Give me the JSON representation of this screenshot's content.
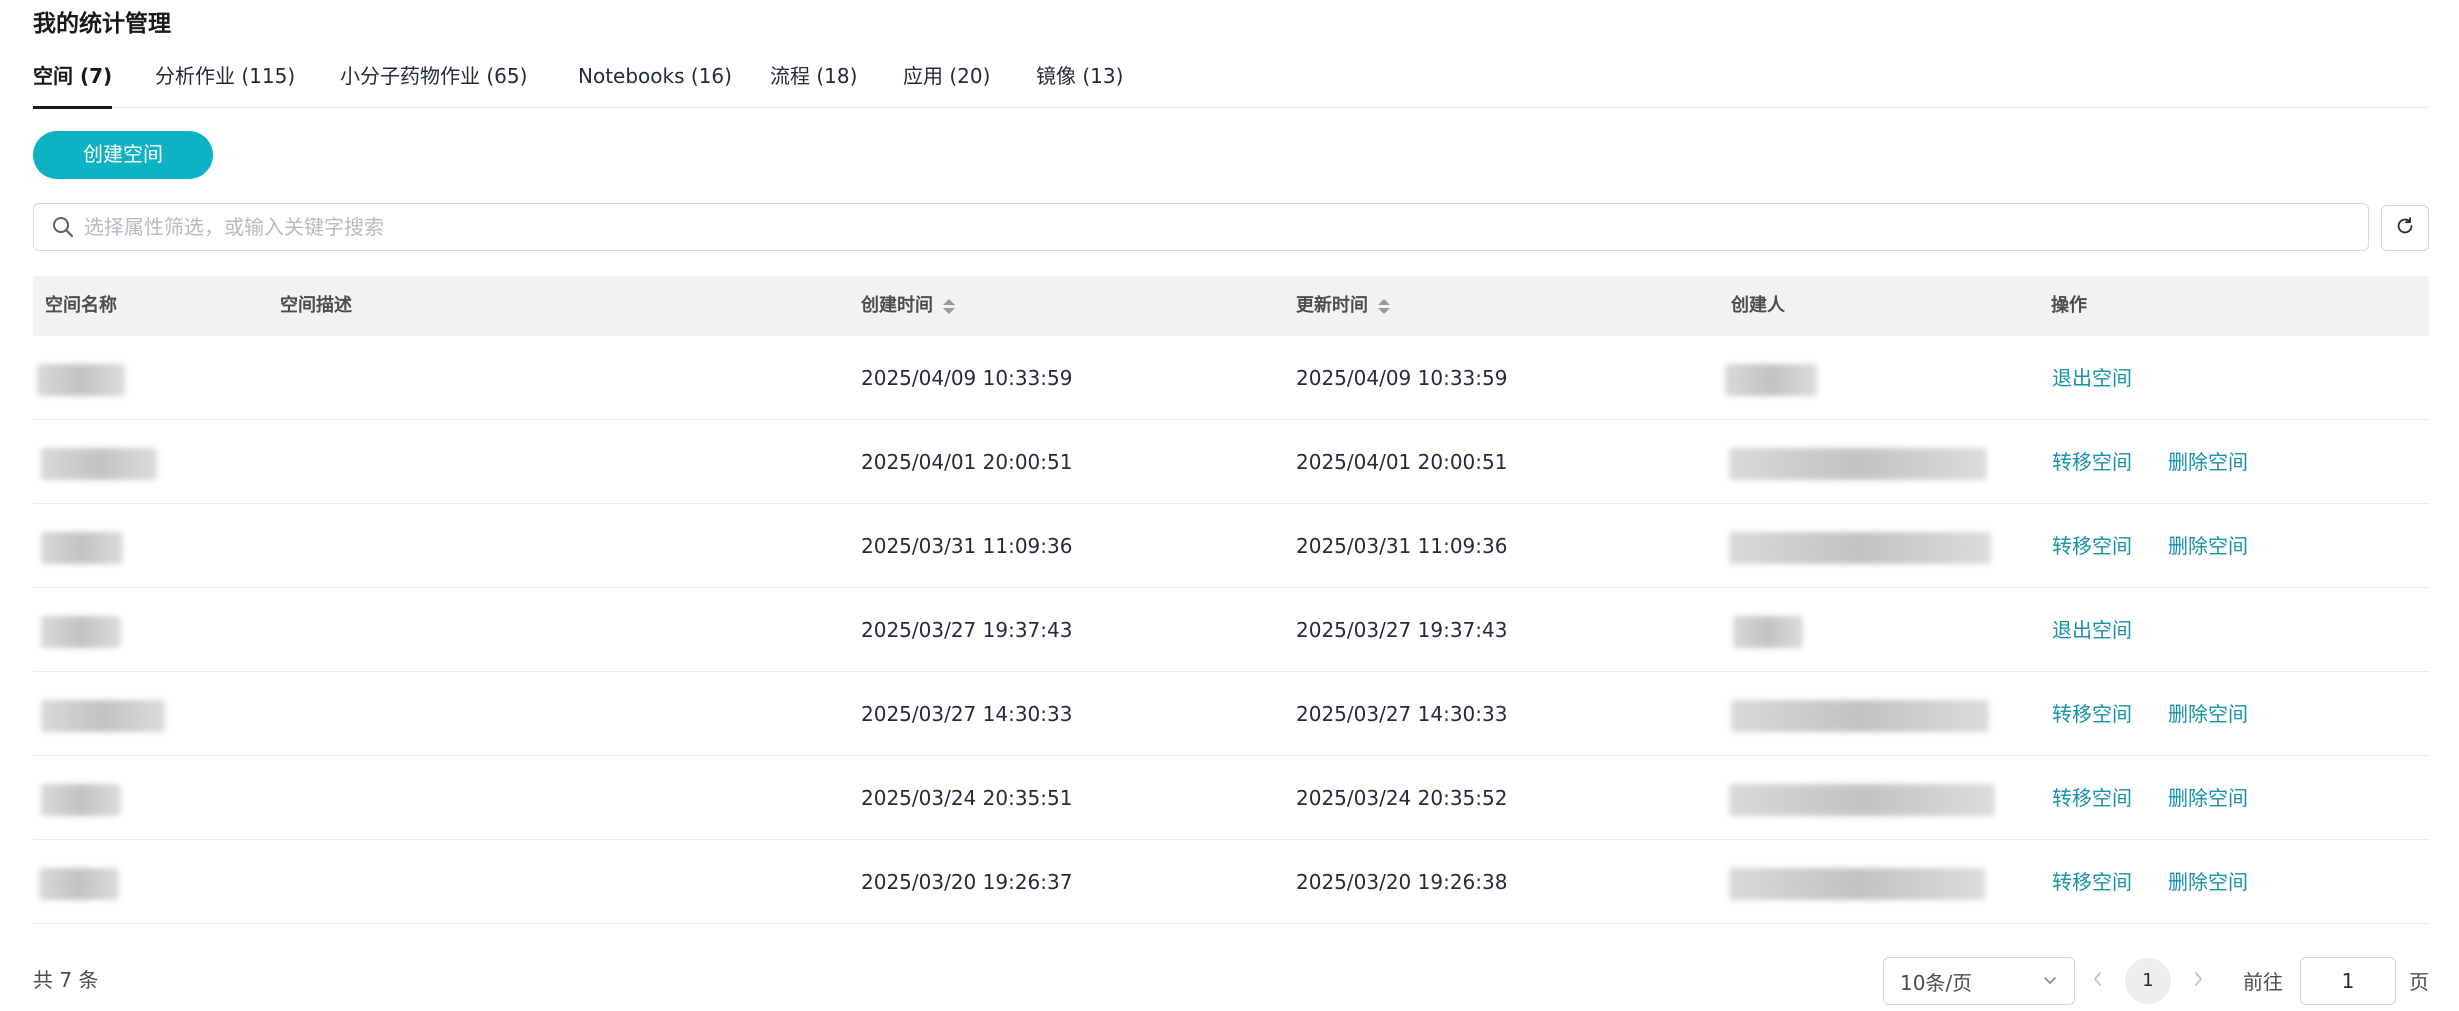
{
  "page": {
    "title": "我的统计管理"
  },
  "tabs": [
    {
      "label": "空间 (7)",
      "active": true
    },
    {
      "label": "分析作业 (115)"
    },
    {
      "label": "小分子药物作业 (65)"
    },
    {
      "label": "Notebooks (16)"
    },
    {
      "label": "流程 (18)"
    },
    {
      "label": "应用 (20)"
    },
    {
      "label": "镜像 (13)"
    }
  ],
  "toolbar": {
    "create_label": "创建空间"
  },
  "search": {
    "placeholder": "选择属性筛选，或输入关键字搜索",
    "value": ""
  },
  "icons": {
    "search": "search-icon",
    "refresh": "refresh-icon",
    "sort": "sort-icon",
    "dropdown": "chevron-down-icon",
    "prev": "chevron-left-icon",
    "next": "chevron-right-icon"
  },
  "table": {
    "columns": {
      "name": "空间名称",
      "description": "空间描述",
      "created": "创建时间",
      "updated": "更新时间",
      "creator": "创建人",
      "actions": "操作"
    },
    "rows": [
      {
        "created": "2025/04/09 10:33:59",
        "updated": "2025/04/09 10:33:59",
        "action1": "退出空间",
        "action2": ""
      },
      {
        "created": "2025/04/01 20:00:51",
        "updated": "2025/04/01 20:00:51",
        "action1": "转移空间",
        "action2": "删除空间"
      },
      {
        "created": "2025/03/31 11:09:36",
        "updated": "2025/03/31 11:09:36",
        "action1": "转移空间",
        "action2": "删除空间"
      },
      {
        "created": "2025/03/27 19:37:43",
        "updated": "2025/03/27 19:37:43",
        "action1": "退出空间",
        "action2": ""
      },
      {
        "created": "2025/03/27 14:30:33",
        "updated": "2025/03/27 14:30:33",
        "action1": "转移空间",
        "action2": "删除空间"
      },
      {
        "created": "2025/03/24 20:35:51",
        "updated": "2025/03/24 20:35:52",
        "action1": "转移空间",
        "action2": "删除空间"
      },
      {
        "created": "2025/03/20 19:26:37",
        "updated": "2025/03/20 19:26:38",
        "action1": "转移空间",
        "action2": "删除空间"
      }
    ]
  },
  "pagination": {
    "total_label": "共 7 条",
    "page_size": "10条/页",
    "current_page": "1",
    "goto_prefix": "前往",
    "goto_value": "1",
    "goto_suffix": "页"
  },
  "colors": {
    "accent": "#0eb2c5",
    "link": "#1592a8",
    "header_bg": "#f2f2f2"
  }
}
